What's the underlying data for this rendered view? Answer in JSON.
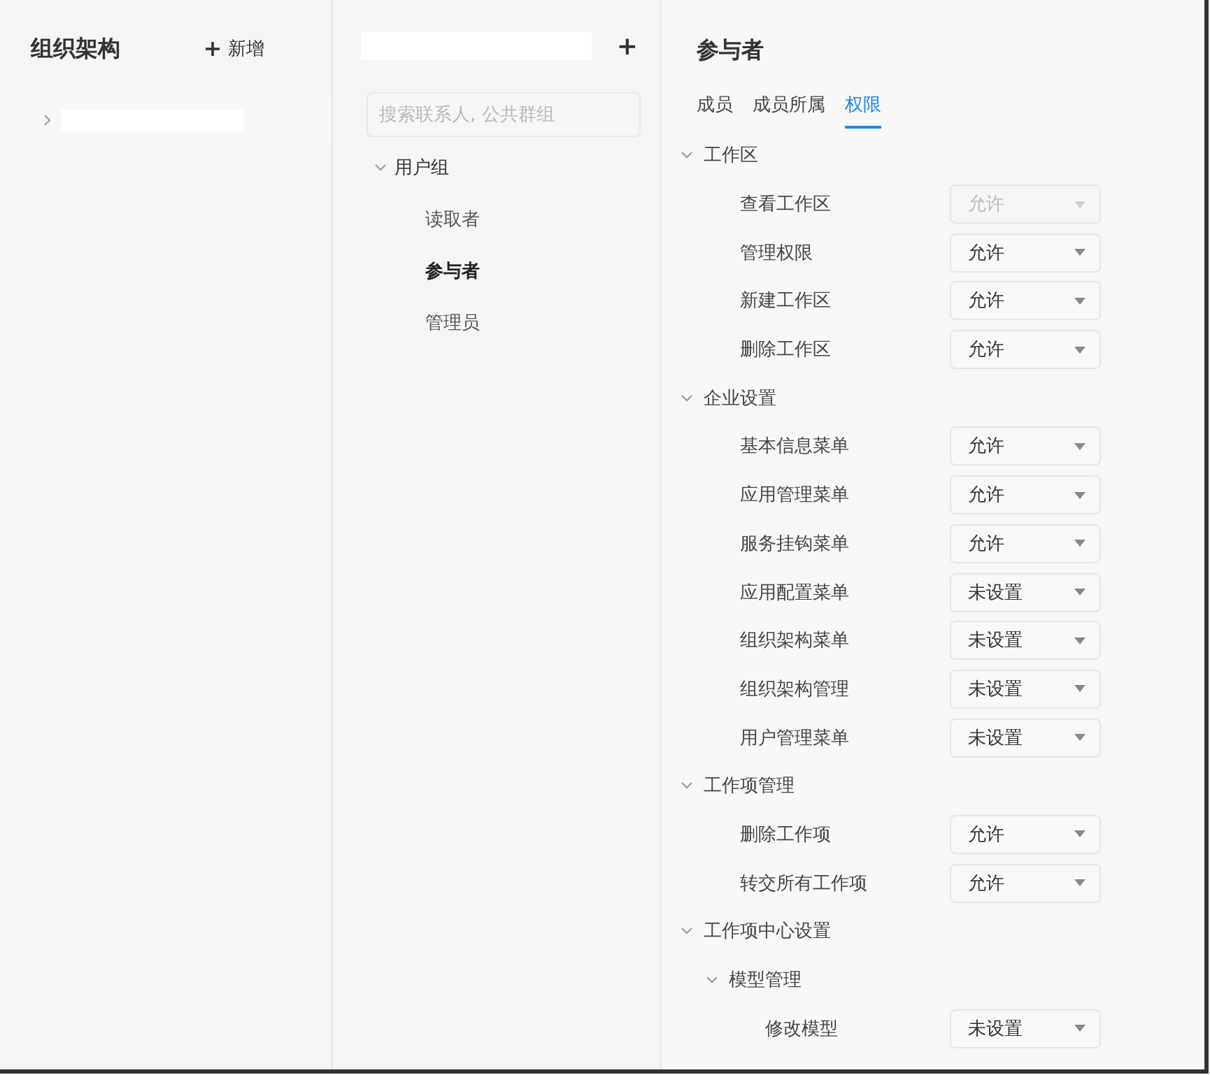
{
  "org_panel": {
    "title": "组织架构",
    "add_button": "新增",
    "tree": [
      {
        "expanded": false
      }
    ]
  },
  "group_panel": {
    "add_button": "+",
    "search": {
      "placeholder": "搜索联系人, 公共群组"
    },
    "tree": [
      {
        "label": "用户组",
        "expanded": true,
        "children": [
          {
            "label": "读取者",
            "selected": false
          },
          {
            "label": "参与者",
            "selected": true
          },
          {
            "label": "管理员",
            "selected": false
          }
        ]
      }
    ]
  },
  "detail": {
    "title": "参与者",
    "tabs": [
      {
        "label": "成员",
        "selected": false
      },
      {
        "label": "成员所属",
        "selected": false
      },
      {
        "label": "权限",
        "selected": true
      }
    ],
    "permissions": [
      {
        "kind": "group",
        "label": "工作区",
        "expanded": true,
        "children": [
          {
            "kind": "permission",
            "label": "查看工作区",
            "value": "允许",
            "disabled": true
          },
          {
            "kind": "permission",
            "label": "管理权限",
            "value": "允许",
            "disabled": false
          },
          {
            "kind": "permission",
            "label": "新建工作区",
            "value": "允许",
            "disabled": false
          },
          {
            "kind": "permission",
            "label": "删除工作区",
            "value": "允许",
            "disabled": false
          }
        ]
      },
      {
        "kind": "group",
        "label": "企业设置",
        "expanded": true,
        "children": [
          {
            "kind": "permission",
            "label": "基本信息菜单",
            "value": "允许",
            "disabled": false
          },
          {
            "kind": "permission",
            "label": "应用管理菜单",
            "value": "允许",
            "disabled": false
          },
          {
            "kind": "permission",
            "label": "服务挂钩菜单",
            "value": "允许",
            "disabled": false
          },
          {
            "kind": "permission",
            "label": "应用配置菜单",
            "value": "未设置",
            "disabled": false
          },
          {
            "kind": "permission",
            "label": "组织架构菜单",
            "value": "未设置",
            "disabled": false
          },
          {
            "kind": "permission",
            "label": "组织架构管理",
            "value": "未设置",
            "disabled": false
          },
          {
            "kind": "permission",
            "label": "用户管理菜单",
            "value": "未设置",
            "disabled": false
          }
        ]
      },
      {
        "kind": "group",
        "label": "工作项管理",
        "expanded": true,
        "children": [
          {
            "kind": "permission",
            "label": "删除工作项",
            "value": "允许",
            "disabled": false
          },
          {
            "kind": "permission",
            "label": "转交所有工作项",
            "value": "允许",
            "disabled": false
          }
        ]
      },
      {
        "kind": "group",
        "label": "工作项中心设置",
        "expanded": true,
        "children": [
          {
            "kind": "group",
            "label": "模型管理",
            "expanded": true,
            "children": [
              {
                "kind": "permission",
                "label": "修改模型",
                "value": "未设置",
                "disabled": false
              }
            ]
          }
        ]
      }
    ]
  }
}
